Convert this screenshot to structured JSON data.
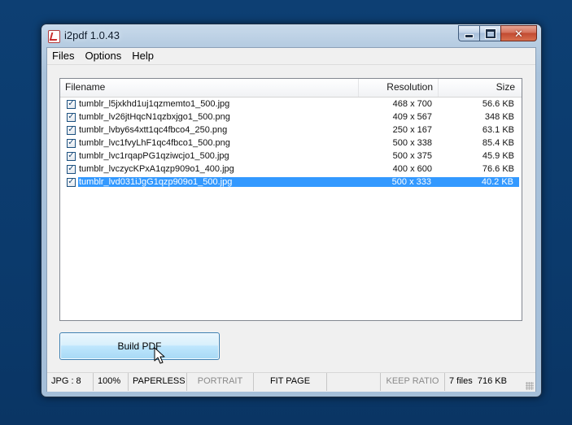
{
  "window": {
    "title": "i2pdf 1.0.43",
    "buttons": {
      "minimize": "minimize",
      "maximize": "maximize",
      "close": "✕"
    }
  },
  "menu": {
    "items": [
      {
        "label": "Files"
      },
      {
        "label": "Options"
      },
      {
        "label": "Help"
      }
    ]
  },
  "list": {
    "columns": {
      "filename": "Filename",
      "resolution": "Resolution",
      "size": "Size"
    },
    "rows": [
      {
        "checked": true,
        "filename": "tumblr_l5jxkhd1uj1qzmemto1_500.jpg",
        "resolution": "468 x 700",
        "size": "56.6 KB",
        "selected": false
      },
      {
        "checked": true,
        "filename": "tumblr_lv26jtHqcN1qzbxjgo1_500.png",
        "resolution": "409 x 567",
        "size": "348 KB",
        "selected": false
      },
      {
        "checked": true,
        "filename": "tumblr_lvby6s4xtt1qc4fbco4_250.png",
        "resolution": "250 x 167",
        "size": "63.1 KB",
        "selected": false
      },
      {
        "checked": true,
        "filename": "tumblr_lvc1fvyLhF1qc4fbco1_500.png",
        "resolution": "500 x 338",
        "size": "85.4 KB",
        "selected": false
      },
      {
        "checked": true,
        "filename": "tumblr_lvc1rqapPG1qziwcjo1_500.jpg",
        "resolution": "500 x 375",
        "size": "45.9 KB",
        "selected": false
      },
      {
        "checked": true,
        "filename": "tumblr_lvczycKPxA1qzp909o1_400.jpg",
        "resolution": "400 x 600",
        "size": "76.6 KB",
        "selected": false
      },
      {
        "checked": true,
        "filename": "tumblr_lvd031iJgG1qzp909o1_500.jpg",
        "resolution": "500 x 333",
        "size": "40.2 KB",
        "selected": true
      }
    ]
  },
  "build_button": {
    "label": "Build PDF"
  },
  "status": {
    "format": "JPG : 8",
    "zoom": "100%",
    "paperless": "PAPERLESS",
    "portrait": "PORTRAIT",
    "fit": "FIT PAGE",
    "keep_ratio": "KEEP RATIO",
    "files": "7 files",
    "total_size": "716 KB"
  },
  "colors": {
    "selection": "#3399ff",
    "desktop": "#0d3f73",
    "frame": "#b7cde2"
  }
}
